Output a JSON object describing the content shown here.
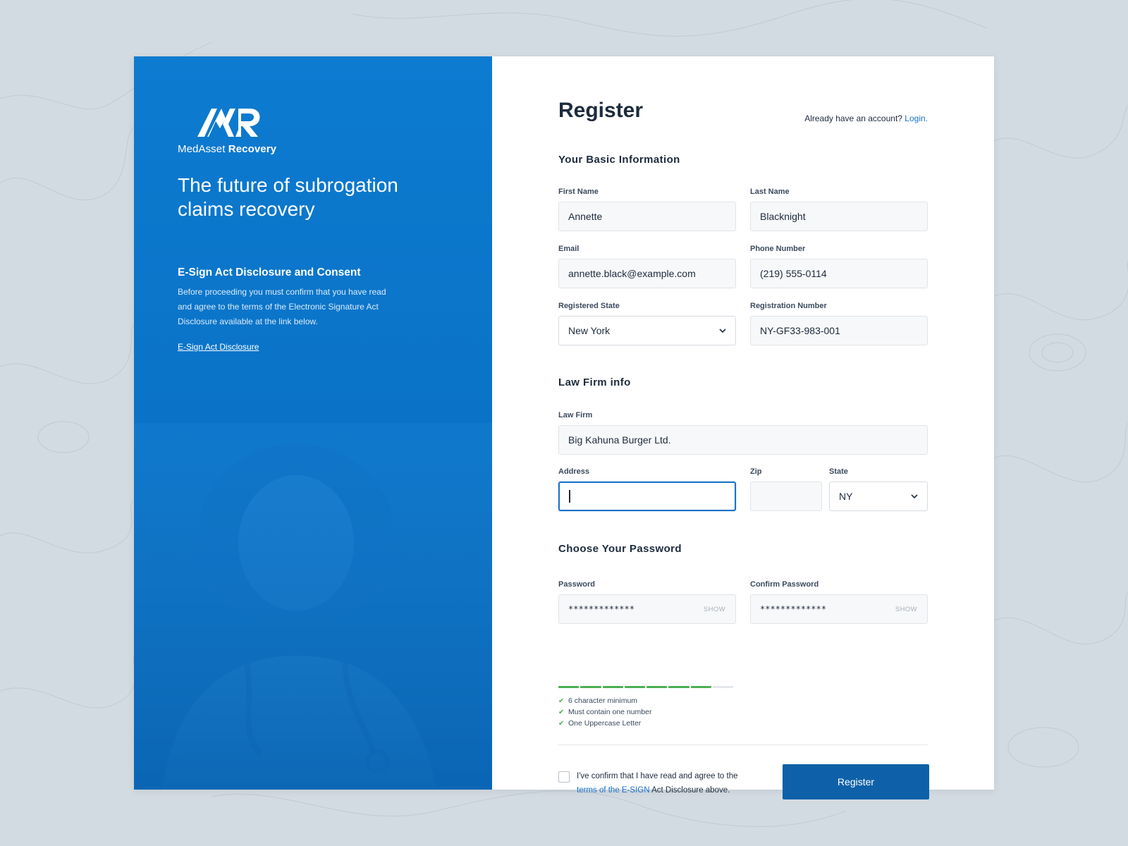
{
  "brand": {
    "name_light": "MedAsset",
    "name_bold": "Recovery"
  },
  "hero": {
    "headline": "The future of subrogation claims recovery"
  },
  "esign": {
    "title": "E-Sign Act Disclosure and Consent",
    "body": "Before proceeding you must confirm that you have read and agree to the terms of the Electronic Signature Act Disclosure available at the link below.",
    "link_label": "E-Sign Act Disclosure"
  },
  "form": {
    "title": "Register",
    "already_text": "Already have an account?",
    "login_label": "Login.",
    "sections": {
      "basic": "Your Basic Information",
      "law_firm": "Law Firm info",
      "password": "Choose Your Password"
    },
    "fields": {
      "first_name": {
        "label": "First Name",
        "value": "Annette"
      },
      "last_name": {
        "label": "Last Name",
        "value": "Blacknight"
      },
      "email": {
        "label": "Email",
        "value": "annette.black@example.com"
      },
      "phone": {
        "label": "Phone Number",
        "value": "(219) 555-0114"
      },
      "registered_state": {
        "label": "Registered State",
        "value": "New York"
      },
      "registration_number": {
        "label": "Registration Number",
        "value": "NY-GF33-983-001"
      },
      "law_firm": {
        "label": "Law Firm",
        "value": "Big Kahuna Burger Ltd."
      },
      "address": {
        "label": "Address",
        "value": ""
      },
      "zip": {
        "label": "Zip",
        "value": ""
      },
      "state": {
        "label": "State",
        "value": "NY"
      },
      "password": {
        "label": "Password",
        "value": "*************",
        "show_label": "SHOW"
      },
      "confirm_password": {
        "label": "Confirm Password",
        "value": "*************",
        "show_label": "SHOW"
      }
    },
    "password_strength": 0.87,
    "password_rules": [
      "6 character minimum",
      "Must contain one number",
      "One Uppercase Letter"
    ],
    "consent": {
      "before": "I've confirm that I have read and agree to the",
      "link": "terms of the E-SIGN",
      "after": "Act Disclosure above."
    },
    "submit_label": "Register"
  },
  "colors": {
    "panel_blue": "#0c7bd0",
    "button_blue": "#0e61a8",
    "link_blue": "#1a73c7",
    "success_green": "#4caf50"
  }
}
